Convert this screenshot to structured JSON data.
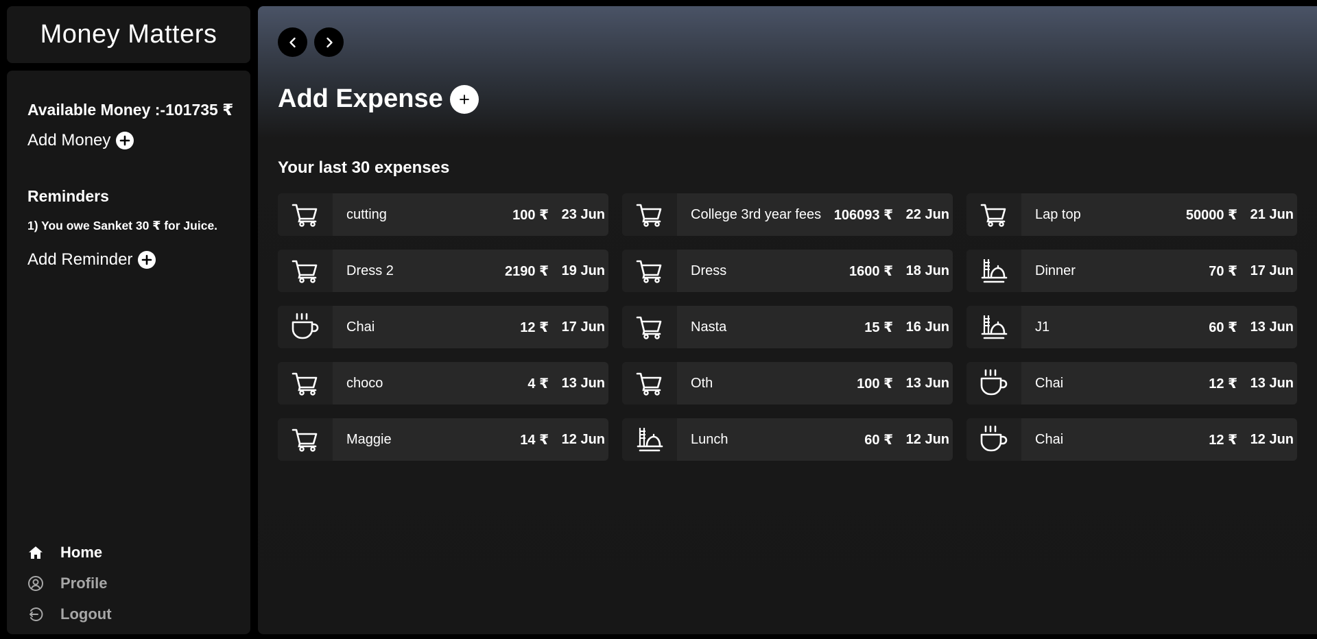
{
  "app_title": "Money Matters",
  "sidebar": {
    "available_money": "Available Money :-101735 ₹",
    "add_money_label": "Add Money",
    "reminders_title": "Reminders",
    "reminders": [
      "1) You owe Sanket 30 ₹ for Juice."
    ],
    "add_reminder_label": "Add Reminder",
    "nav": [
      {
        "label": "Home",
        "icon": "home-icon",
        "active": true
      },
      {
        "label": "Profile",
        "icon": "profile-icon",
        "active": false
      },
      {
        "label": "Logout",
        "icon": "logout-icon",
        "active": false
      }
    ]
  },
  "main": {
    "title": "Add Expense",
    "subtitle": "Your last 30 expenses",
    "expenses": [
      {
        "name": "cutting",
        "amount": "100 ₹",
        "date": "23 Jun",
        "icon": "cart-icon"
      },
      {
        "name": "College 3rd year fees",
        "amount": "106093 ₹",
        "date": "22 Jun",
        "icon": "cart-icon"
      },
      {
        "name": "Lap top",
        "amount": "50000 ₹",
        "date": "21 Jun",
        "icon": "cart-icon"
      },
      {
        "name": "Dress 2",
        "amount": "2190 ₹",
        "date": "19 Jun",
        "icon": "cart-icon"
      },
      {
        "name": "Dress",
        "amount": "1600 ₹",
        "date": "18 Jun",
        "icon": "cart-icon"
      },
      {
        "name": "Dinner",
        "amount": "70 ₹",
        "date": "17 Jun",
        "icon": "food-icon"
      },
      {
        "name": "Chai",
        "amount": "12 ₹",
        "date": "17 Jun",
        "icon": "cup-icon"
      },
      {
        "name": "Nasta",
        "amount": "15 ₹",
        "date": "16 Jun",
        "icon": "cart-icon"
      },
      {
        "name": "J1",
        "amount": "60 ₹",
        "date": "13 Jun",
        "icon": "food-icon"
      },
      {
        "name": "choco",
        "amount": "4 ₹",
        "date": "13 Jun",
        "icon": "cart-icon"
      },
      {
        "name": "Oth",
        "amount": "100 ₹",
        "date": "13 Jun",
        "icon": "cart-icon"
      },
      {
        "name": "Chai",
        "amount": "12 ₹",
        "date": "13 Jun",
        "icon": "cup-icon"
      },
      {
        "name": "Maggie",
        "amount": "14 ₹",
        "date": "12 Jun",
        "icon": "cart-icon"
      },
      {
        "name": "Lunch",
        "amount": "60 ₹",
        "date": "12 Jun",
        "icon": "food-icon"
      },
      {
        "name": "Chai",
        "amount": "12 ₹",
        "date": "12 Jun",
        "icon": "cup-icon"
      }
    ]
  }
}
